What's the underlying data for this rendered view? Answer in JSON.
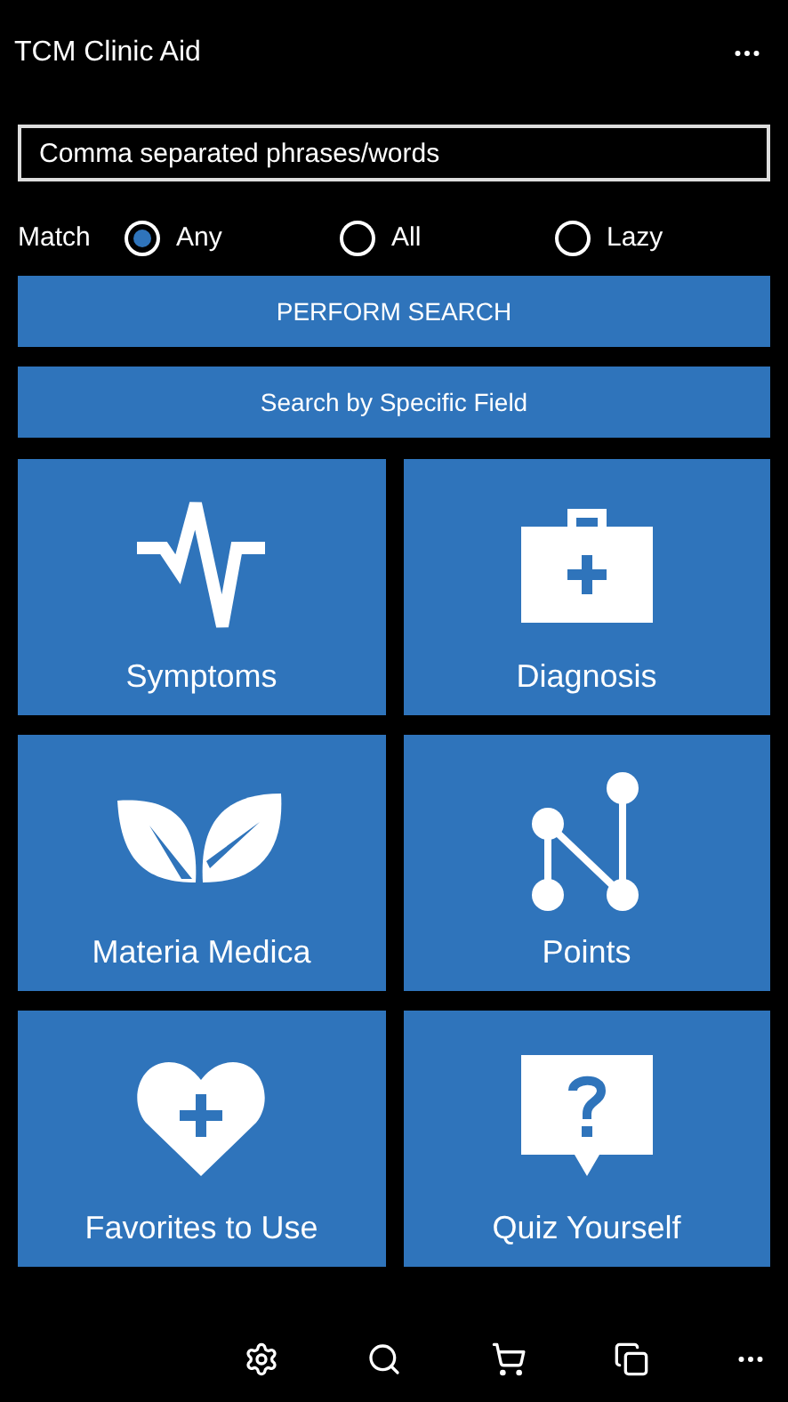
{
  "app_title": "TCM Clinic Aid",
  "search": {
    "placeholder": "Comma separated phrases/words"
  },
  "match": {
    "label": "Match",
    "options": [
      {
        "label": "Any",
        "selected": true
      },
      {
        "label": "All",
        "selected": false
      },
      {
        "label": "Lazy",
        "selected": false
      }
    ]
  },
  "buttons": [
    "PERFORM SEARCH",
    "Search by Specific Field"
  ],
  "tiles": [
    {
      "label": "Symptoms",
      "kind": "pulse"
    },
    {
      "label": "Diagnosis",
      "kind": "kit"
    },
    {
      "label": "Materia Medica",
      "kind": "leaves"
    },
    {
      "label": "Points",
      "kind": "points"
    },
    {
      "label": "Favorites to Use",
      "kind": "heart"
    },
    {
      "label": "Quiz Yourself",
      "kind": "quiz"
    }
  ]
}
